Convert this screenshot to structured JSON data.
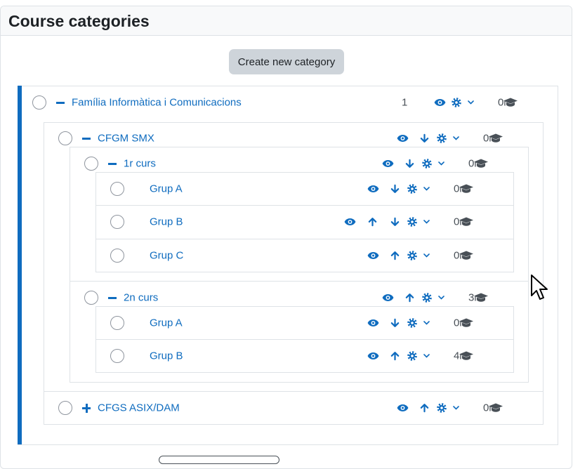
{
  "page": {
    "title": "Course categories"
  },
  "toolbar": {
    "create_label": "Create new category"
  },
  "categories": {
    "informatica": {
      "name": "Família Informàtica i Comunicacions",
      "course_count": "1",
      "subcategory_count": "0",
      "toggle": "collapse"
    },
    "smx": {
      "name": "CFGM SMX",
      "subcategory_count": "0",
      "toggle": "collapse"
    },
    "smx_1r": {
      "name": "1r curs",
      "subcategory_count": "0",
      "toggle": "collapse"
    },
    "smx_1r_a": {
      "name": "Grup A",
      "subcategory_count": "0"
    },
    "smx_1r_b": {
      "name": "Grup B",
      "subcategory_count": "0"
    },
    "smx_1r_c": {
      "name": "Grup C",
      "subcategory_count": "0"
    },
    "smx_2n": {
      "name": "2n curs",
      "subcategory_count": "3",
      "toggle": "collapse"
    },
    "smx_2n_a": {
      "name": "Grup A",
      "subcategory_count": "0"
    },
    "smx_2n_b": {
      "name": "Grup B",
      "subcategory_count": "4"
    },
    "asix": {
      "name": "CFGS ASIX/DAM",
      "subcategory_count": "0",
      "toggle": "expand"
    }
  },
  "icons": {
    "visibility": "eye-icon",
    "move_up": "arrow-up-icon",
    "move_down": "arrow-down-icon",
    "settings": "gear-icon",
    "menu": "chevron-down-icon",
    "subcategories": "graduation-cap-icon",
    "toggle_collapse": "minus-icon",
    "toggle_expand": "plus-icon"
  },
  "colors": {
    "link": "#0f6cbf",
    "accent_bar": "#0f6cbf",
    "button_bg": "#ced4da",
    "border": "#dee2e6",
    "muted_text": "#495057"
  }
}
